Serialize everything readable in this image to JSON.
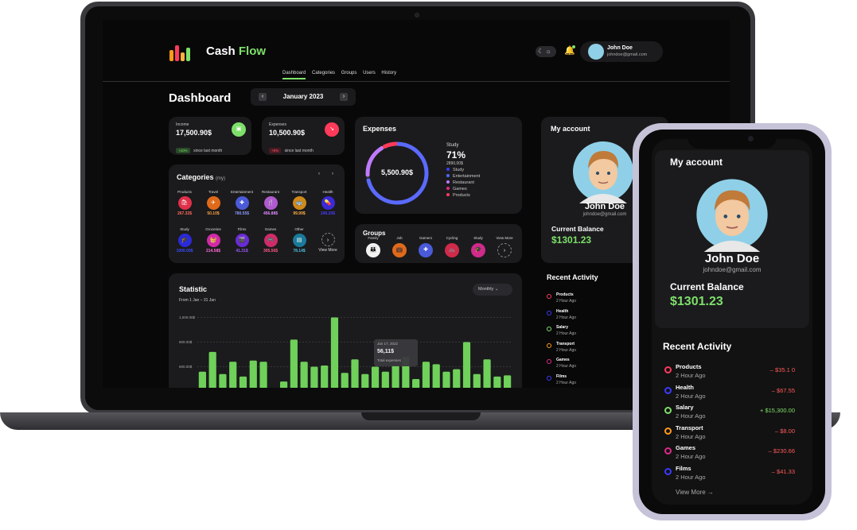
{
  "app": {
    "brand_a": "Cash",
    "brand_b": "Flow"
  },
  "user": {
    "name": "John Doe",
    "email": "johndoe@gmail.com"
  },
  "nav": [
    "Dashboard",
    "Categories",
    "Groups",
    "Users",
    "History"
  ],
  "page": {
    "title": "Dashboard",
    "month": "January 2023"
  },
  "income": {
    "label": "Income",
    "value": "17,500.90$",
    "badge": "+10%",
    "note": "since last month"
  },
  "expenses_card": {
    "label": "Expenses",
    "value": "10,500.90$",
    "badge": "+8%",
    "note": "since last month"
  },
  "categories": {
    "title": "Categories",
    "suffix": "(my)",
    "items": [
      {
        "name": "Products",
        "value": "267.32$",
        "color": "#e0304a",
        "vcolor": "#ff6a5a",
        "icon": "🛍"
      },
      {
        "name": "Travel",
        "value": "50.10$",
        "color": "#e06a1a",
        "vcolor": "#ffa040",
        "icon": "✈"
      },
      {
        "name": "Entertainment",
        "value": "780.55$",
        "color": "#4a5ad8",
        "vcolor": "#8a9aff",
        "icon": "✚"
      },
      {
        "name": "Restaurant",
        "value": "456.88$",
        "color": "#b05ad0",
        "vcolor": "#e08aff",
        "icon": "🍴"
      },
      {
        "name": "Transport",
        "value": "99.99$",
        "color": "#d08a1a",
        "vcolor": "#ffb040",
        "icon": "🚌"
      },
      {
        "name": "Health",
        "value": "240.20$",
        "color": "#3a2ad8",
        "vcolor": "#4a3aff",
        "icon": "💊"
      },
      {
        "name": "Study",
        "value": "1000.00$",
        "color": "#2a2ad8",
        "vcolor": "#3a4aff",
        "icon": "🎓"
      },
      {
        "name": "Groceries",
        "value": "214.58$",
        "color": "#d02aa8",
        "vcolor": "#ff6ad8",
        "icon": "🧺"
      },
      {
        "name": "Films",
        "value": "41.31$",
        "color": "#6a2ad8",
        "vcolor": "#9a5aff",
        "icon": "🎬"
      },
      {
        "name": "Games",
        "value": "305.56$",
        "color": "#d02a6a",
        "vcolor": "#ff5a8a",
        "icon": "🎮"
      },
      {
        "name": "Other",
        "value": "78.14$",
        "color": "#1a7a9a",
        "vcolor": "#4ac0e0",
        "icon": "▤"
      }
    ],
    "view_more": "View More"
  },
  "expenses": {
    "title": "Expenses",
    "total": "5,500.90$",
    "focus_label": "Study",
    "focus_pct": "71%",
    "focus_value": "2890,00$",
    "legend": [
      {
        "name": "Study",
        "color": "#3a3aff"
      },
      {
        "name": "Entertainment",
        "color": "#4a6aff"
      },
      {
        "name": "Restaurant",
        "color": "#c07aff"
      },
      {
        "name": "Games",
        "color": "#e02a8a"
      },
      {
        "name": "Products",
        "color": "#ff3a5a"
      }
    ]
  },
  "groups": {
    "title": "Groups",
    "items": [
      {
        "name": "Family",
        "color": "#f2f2f2",
        "icon": "👪"
      },
      {
        "name": "Job",
        "color": "#e06a1a",
        "icon": "💼"
      },
      {
        "name": "Gamers",
        "color": "#4a5ad8",
        "icon": "✚"
      },
      {
        "name": "Cycling",
        "color": "#d02a4a",
        "icon": "🚲"
      },
      {
        "name": "Study",
        "color": "#d02a8a",
        "icon": "🎓"
      }
    ],
    "view_more": "View More"
  },
  "statistic": {
    "title": "Statistic",
    "range": "From 1 Jan – 31 Jan",
    "select": "Monthly",
    "tooltip_date": "Jan 17, 2022",
    "tooltip_value": "56,11$",
    "tooltip_label": "Total expenses"
  },
  "chart_data": {
    "type": "bar",
    "yticks": [
      "1,000.00$",
      "800.00$",
      "600.00$",
      "400.00$"
    ],
    "ylim": [
      300,
      1100
    ],
    "values": [
      560,
      720,
      540,
      640,
      520,
      650,
      640,
      380,
      480,
      820,
      640,
      600,
      610,
      1000,
      550,
      660,
      540,
      600,
      560,
      610,
      680,
      500,
      640,
      620,
      560,
      580,
      800,
      540,
      660,
      520,
      530
    ]
  },
  "account": {
    "title": "My account",
    "balance_label": "Current Balance",
    "balance": "$1301.23"
  },
  "activity": {
    "title": "Recent Activity",
    "view_more": "View More",
    "items": [
      {
        "name": "Products",
        "time": "2 Hour Ago",
        "amount": "– $35.1 0",
        "color": "#ff3a5a",
        "acolor": "#ff5a5a"
      },
      {
        "name": "Health",
        "time": "2 Hour Ago",
        "amount": "– $67.55",
        "color": "#3a3aff",
        "acolor": "#ff5a5a"
      },
      {
        "name": "Salary",
        "time": "2 Hour Ago",
        "amount": "+ $15,300.00",
        "color": "#7ee06a",
        "acolor": "#7ee06a"
      },
      {
        "name": "Transport",
        "time": "2 Hour Ago",
        "amount": "– $8.00",
        "color": "#ff9a1a",
        "acolor": "#ff5a5a"
      },
      {
        "name": "Games",
        "time": "2 Hour Ago",
        "amount": "– $230.66",
        "color": "#e02a8a",
        "acolor": "#ff5a5a"
      },
      {
        "name": "Films",
        "time": "2 Hour Ago",
        "amount": "– $41.33",
        "color": "#3a3aff",
        "acolor": "#ff5a5a"
      }
    ],
    "laptop_amounts": [
      "– $",
      "",
      "+ $15",
      "",
      "– $",
      ""
    ]
  }
}
